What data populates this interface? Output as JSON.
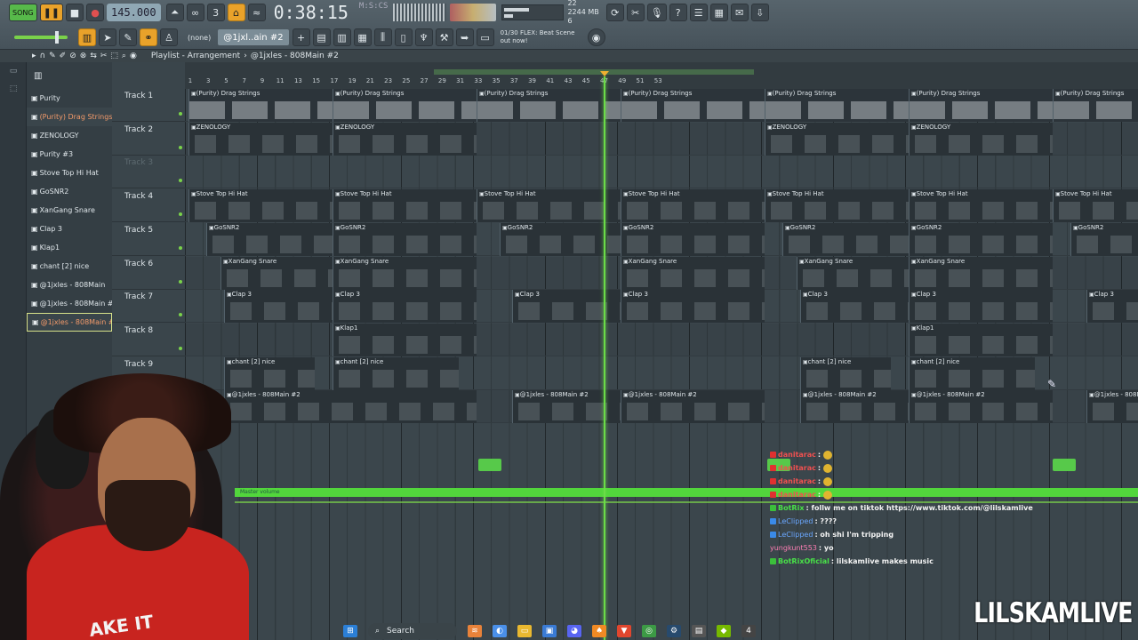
{
  "toolbar": {
    "mode_label": "SONG",
    "tempo": "145.000",
    "time": "0:38:15",
    "time_unit": "M:S:CS",
    "memory": "2244 MB",
    "cpu_count": "22",
    "voices": "6",
    "pattern": "@1jxl..ain #2",
    "snap": "(none)",
    "hint_line1": "01/30  FLEX: Beat Scene",
    "hint_line2": "out now!"
  },
  "playlist": {
    "title": "Playlist - Arrangement",
    "separator": "›",
    "pattern_name": "@1jxles - 808Main #2"
  },
  "picker": {
    "items": [
      {
        "label": "Purity"
      },
      {
        "label": "(Purity) Drag Strings"
      },
      {
        "label": "ZENOLOGY"
      },
      {
        "label": "Purity #3"
      },
      {
        "label": "Stove Top Hi Hat"
      },
      {
        "label": "GoSNR2"
      },
      {
        "label": "XanGang Snare"
      },
      {
        "label": "Clap 3"
      },
      {
        "label": "Klap1"
      },
      {
        "label": "chant [2] nice"
      },
      {
        "label": "@1jxles - 808Main"
      },
      {
        "label": "@1jxles - 808Main #3"
      },
      {
        "label": "@1jxles - 808Main #2"
      }
    ]
  },
  "tracks": [
    {
      "label": "Track 1"
    },
    {
      "label": "Track 2"
    },
    {
      "label": "Track 3"
    },
    {
      "label": "Track 4"
    },
    {
      "label": "Track 5"
    },
    {
      "label": "Track 6"
    },
    {
      "label": "Track 7"
    },
    {
      "label": "Track 8"
    },
    {
      "label": "Track 9"
    }
  ],
  "ruler": {
    "bars": [
      "1",
      "3",
      "5",
      "7",
      "9",
      "11",
      "13",
      "15",
      "17",
      "19",
      "21",
      "23",
      "25",
      "27",
      "29",
      "31",
      "33",
      "35",
      "37",
      "39",
      "41",
      "43",
      "45",
      "47",
      "49",
      "51",
      "53"
    ]
  },
  "clips": {
    "t1": "(Purity) Drag Strings",
    "t2": "ZENOLOGY",
    "t4": "Stove Top Hi Hat",
    "t5": "GoSNR2",
    "t6": "XanGang Snare",
    "t7": "Clap 3",
    "t8": "Klap1",
    "t9": "chant [2] nice",
    "t10": "@1jxles - 808Main #2"
  },
  "automation_label": "Master volume",
  "chat": [
    {
      "user": "danitarac",
      "msg": ":",
      "color": "red"
    },
    {
      "user": "danitarac",
      "msg": ":",
      "color": "red"
    },
    {
      "user": "danitarac",
      "msg": ":",
      "color": "red"
    },
    {
      "user": "danitarac",
      "msg": ":",
      "color": "red"
    },
    {
      "user": "BotRix",
      "msg": ": follw me on tiktok https://www.tiktok.com/@lilskamlive",
      "color": "green"
    },
    {
      "user": "LeClipped",
      "msg": ": ????",
      "color": "blue"
    },
    {
      "user": "LeClipped",
      "msg": ": oh shi I'm tripping",
      "color": "blue"
    },
    {
      "user": "yungkunt553",
      "msg": ": yo",
      "color": "pink"
    },
    {
      "user": "BotRixOficial",
      "msg": ": lilskamlive makes music",
      "color": "green"
    }
  ],
  "taskbar": {
    "search_label": "Search",
    "search_icon": "search-icon"
  },
  "webcam": {
    "hoodie_text": "AKE IT"
  },
  "watermark": "LILSKAMLIVE"
}
